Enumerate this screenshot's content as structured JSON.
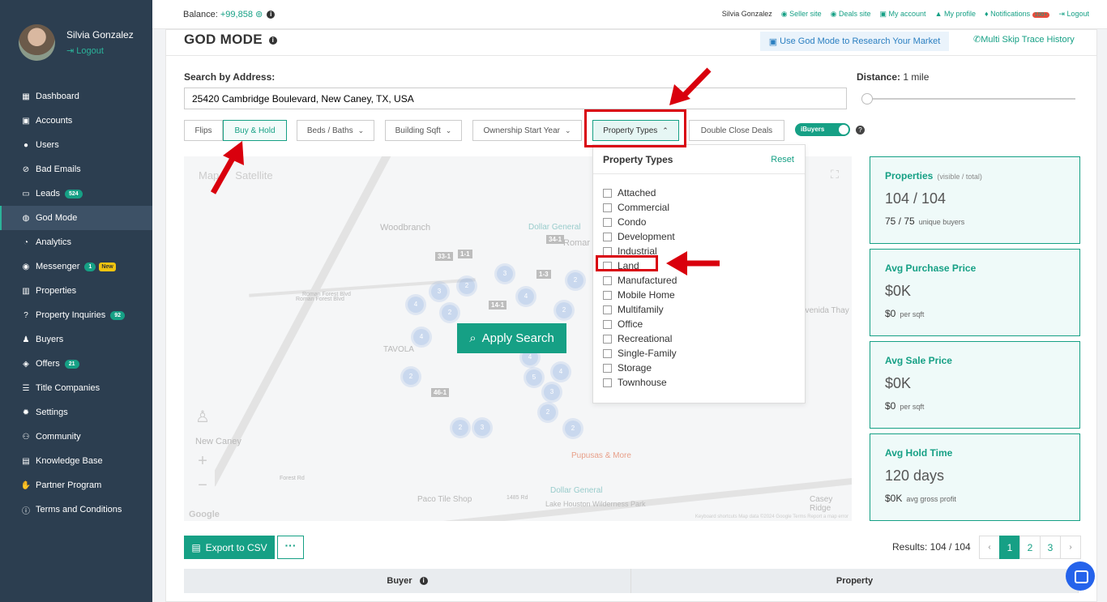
{
  "sidebar": {
    "user_name": "Silvia Gonzalez",
    "logout": "Logout",
    "items": [
      {
        "label": "Dashboard",
        "icon": "dashboard-icon"
      },
      {
        "label": "Accounts",
        "icon": "briefcase-icon"
      },
      {
        "label": "Users",
        "icon": "user-icon"
      },
      {
        "label": "Bad Emails",
        "icon": "ban-icon"
      },
      {
        "label": "Leads",
        "icon": "leads-icon",
        "badge": "524"
      },
      {
        "label": "God Mode",
        "icon": "globe-icon",
        "active": true
      },
      {
        "label": "Analytics",
        "icon": "chart-icon"
      },
      {
        "label": "Messenger",
        "icon": "chat-icon",
        "badge": "1",
        "badge2": "New"
      },
      {
        "label": "Properties",
        "icon": "building-icon"
      },
      {
        "label": "Property Inquiries",
        "icon": "question-icon",
        "badge": "92"
      },
      {
        "label": "Buyers",
        "icon": "buyers-icon"
      },
      {
        "label": "Offers",
        "icon": "offers-icon",
        "badge": "21"
      },
      {
        "label": "Title Companies",
        "icon": "list-icon"
      },
      {
        "label": "Settings",
        "icon": "gear-icon"
      },
      {
        "label": "Community",
        "icon": "community-icon"
      },
      {
        "label": "Knowledge Base",
        "icon": "book-icon"
      },
      {
        "label": "Partner Program",
        "icon": "handshake-icon"
      },
      {
        "label": "Terms and Conditions",
        "icon": "info-icon"
      }
    ]
  },
  "topbar": {
    "balance_label": "Balance:",
    "balance_value": "+99,858",
    "user": "Silvia Gonzalez",
    "seller_site": "Seller site",
    "deals_site": "Deals site",
    "my_account": "My account",
    "my_profile": "My profile",
    "notifications": "Notifications",
    "notif_badge": "100+",
    "logout": "Logout"
  },
  "page": {
    "title": "GOD MODE",
    "research_btn": "Use God Mode to Research Your Market",
    "skip_trace": "Multi Skip Trace History",
    "search_label": "Search by Address:",
    "search_value": "25420 Cambridge Boulevard, New Caney, TX, USA",
    "distance_label": "Distance:",
    "distance_value": "1 mile"
  },
  "filters": {
    "flips": "Flips",
    "buy_hold": "Buy & Hold",
    "beds_baths": "Beds / Baths",
    "building_sqft": "Building Sqft",
    "ownership": "Ownership Start Year",
    "property_types": "Property Types",
    "double_close": "Double Close Deals",
    "ibuyers": "iBuyers"
  },
  "dropdown": {
    "title": "Property Types",
    "reset": "Reset",
    "options": [
      "Attached",
      "Commercial",
      "Condo",
      "Development",
      "Industrial",
      "Land",
      "Manufactured",
      "Mobile Home",
      "Multifamily",
      "Office",
      "Recreational",
      "Single-Family",
      "Storage",
      "Townhouse"
    ]
  },
  "map": {
    "tab_map": "Map",
    "tab_satellite": "Satellite",
    "apply": "Apply Search",
    "labels": [
      "Woodbranch",
      "Romar",
      "Roman Forest Blvd",
      "TAVOLA",
      "New Caney",
      "Pupusas & More",
      "Dollar General",
      "Dollar General",
      "Paco Tile Shop",
      "Lake Houston Wilderness Park",
      "Casey Ridge",
      "Avenida Thay",
      "Roman Forest Blvd",
      "Forest Rd",
      "1485 Rd"
    ],
    "google": "Google",
    "footer": "Keyboard shortcuts   Map data ©2024 Google   Terms   Report a map error"
  },
  "stats": [
    {
      "label": "Properties",
      "note": "(visible / total)",
      "value": "104 / 104",
      "sub": "75 / 75",
      "sub_note": "unique buyers"
    },
    {
      "label": "Avg Purchase Price",
      "note": "",
      "value": "$0K",
      "sub": "$0",
      "sub_note": "per sqft"
    },
    {
      "label": "Avg Sale Price",
      "note": "",
      "value": "$0K",
      "sub": "$0",
      "sub_note": "per sqft"
    },
    {
      "label": "Avg Hold Time",
      "note": "",
      "value": "120 days",
      "sub": "$0K",
      "sub_note": "avg gross profit"
    }
  ],
  "bottom": {
    "export": "Export to CSV",
    "more": "···",
    "results": "Results: 104 / 104",
    "pages": [
      "1",
      "2",
      "3"
    ],
    "prev": "‹",
    "next": "›",
    "col_buyer": "Buyer",
    "col_property": "Property"
  },
  "colors": {
    "accent": "#16a085",
    "sidebar": "#2c3e50",
    "annotation": "#d9000d"
  }
}
